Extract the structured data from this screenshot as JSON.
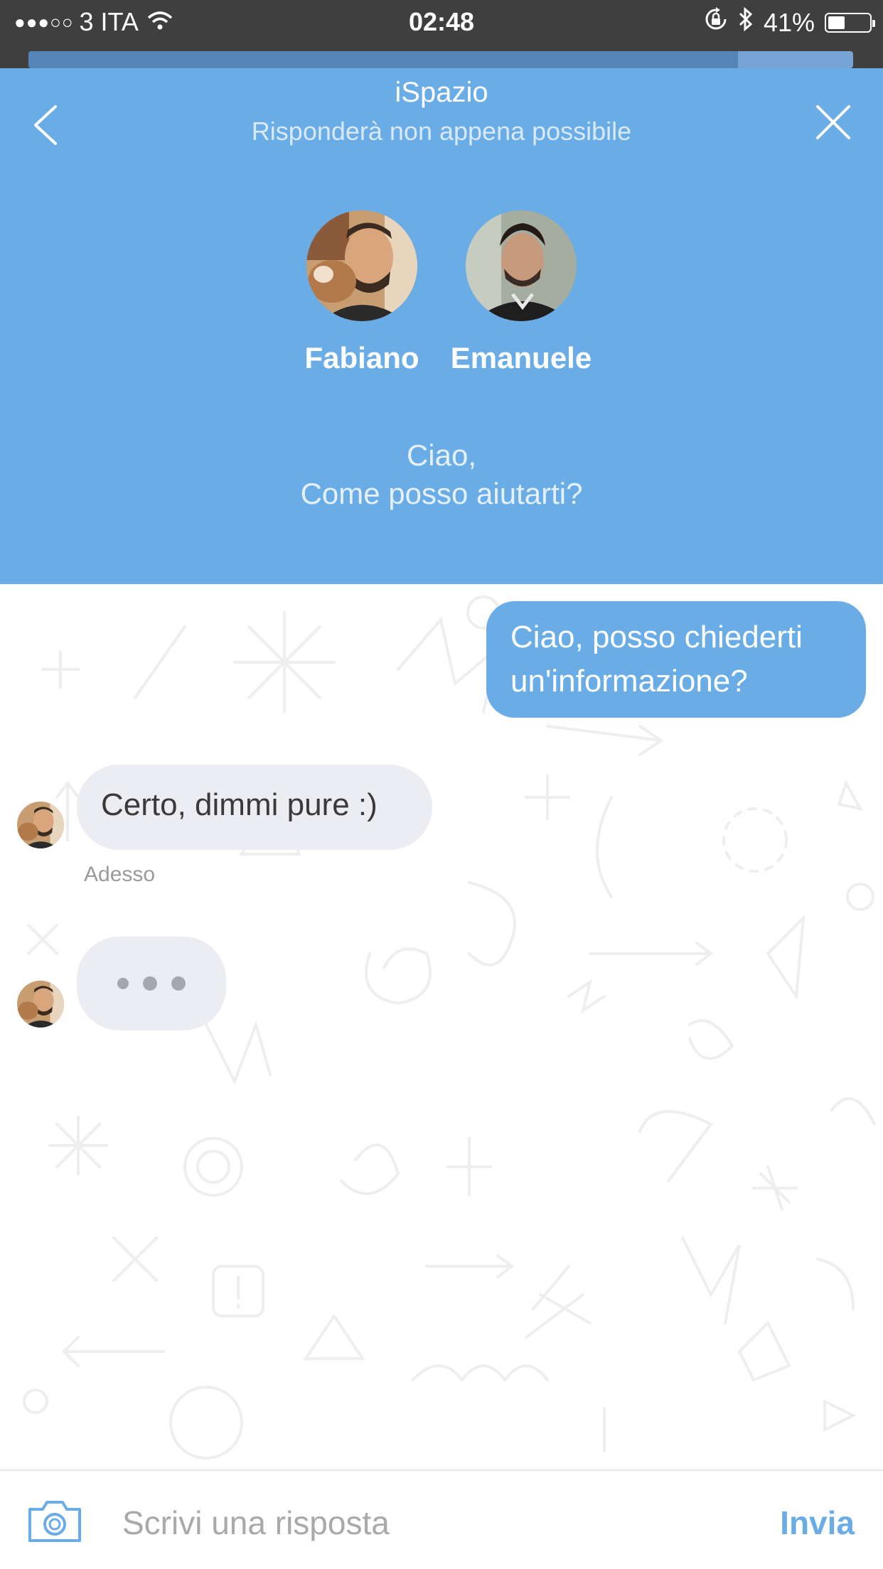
{
  "status_bar": {
    "carrier": "3 ITA",
    "signal_dots": "●●●○○",
    "time": "02:48",
    "battery": "41%",
    "battery_level": 0.41,
    "icons": [
      "signal-icon",
      "wifi-icon",
      "orientation-lock-icon",
      "bluetooth-icon",
      "battery-icon"
    ]
  },
  "progress": {
    "fraction": 0.86
  },
  "header": {
    "title": "iSpazio",
    "subtitle": "Risponderà non appena possibile",
    "agents": [
      {
        "name": "Fabiano"
      },
      {
        "name": "Emanuele"
      }
    ],
    "greeting_line1": "Ciao,",
    "greeting_line2": "Come posso aiutarti?",
    "background_color": "#6aace6"
  },
  "messages": {
    "outgoing_1": "Ciao, posso chiederti un'informazione?",
    "incoming_1": "Certo, dimmi pure :)",
    "incoming_1_time": "Adesso"
  },
  "composer": {
    "placeholder": "Scrivi una risposta",
    "send_label": "Invia",
    "accent_color": "#6aace6"
  }
}
